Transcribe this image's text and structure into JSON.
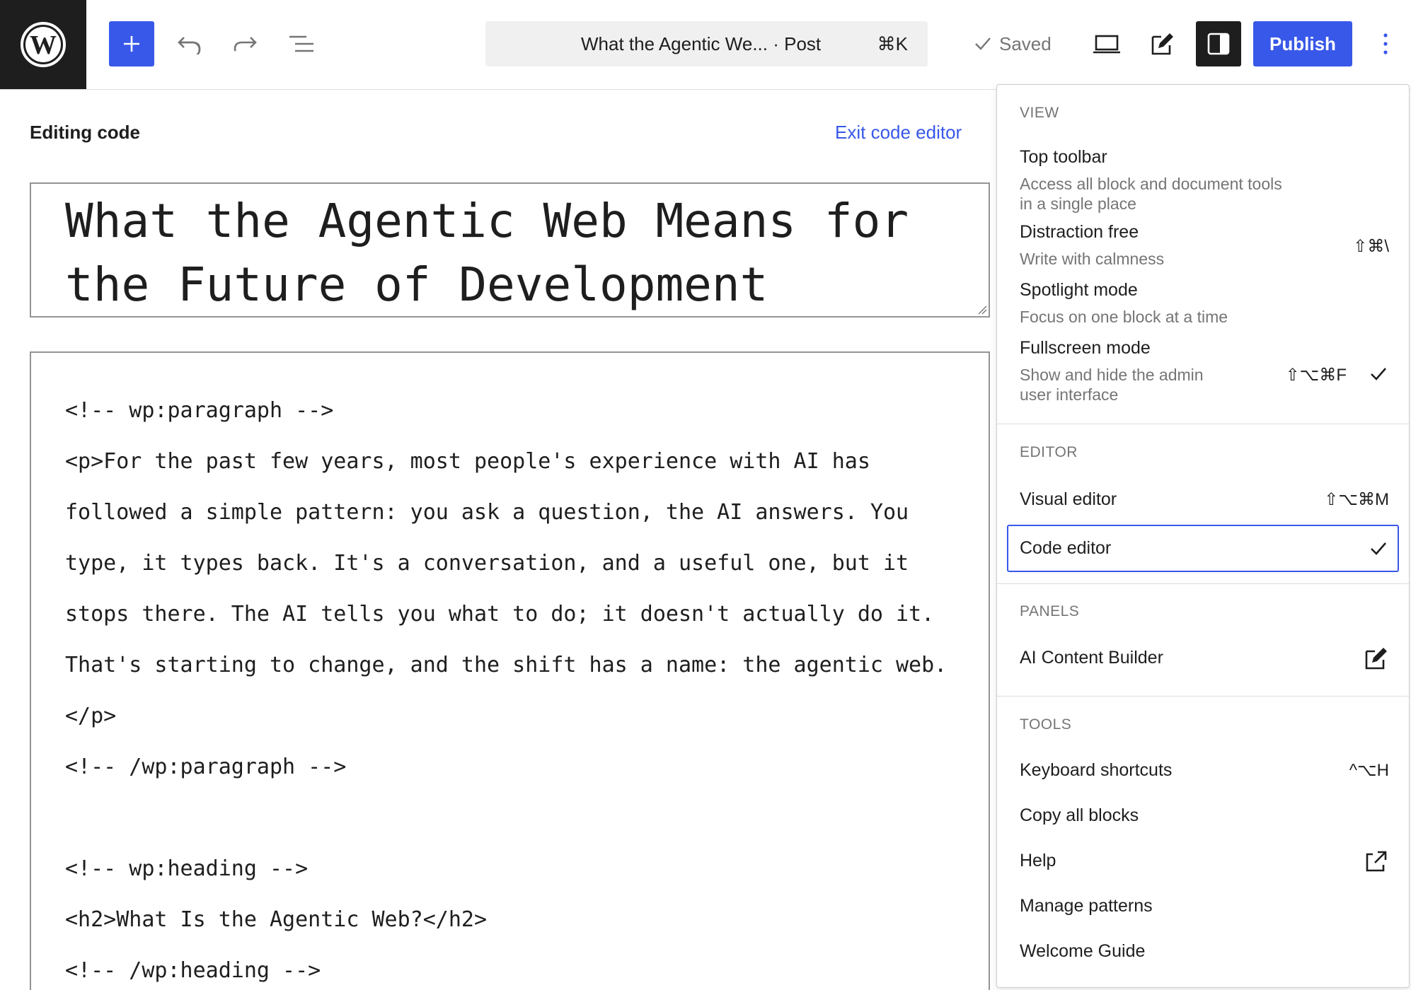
{
  "header": {
    "logo": "wordpress-logo",
    "icons": {
      "inserter": "plus-icon",
      "undo": "undo-icon",
      "redo": "redo-icon",
      "list_view": "list-view-icon",
      "preview": "desktop-icon",
      "edit": "edit-icon",
      "settings": "sidebar-icon",
      "options": "more-vertical-icon"
    },
    "command_bar": {
      "title": "What the Agentic We...",
      "type": "· Post",
      "shortcut": "⌘K"
    },
    "saved_label": "Saved",
    "publish_label": "Publish"
  },
  "editor": {
    "mode_label": "Editing code",
    "exit_label": "Exit code editor",
    "post_title_line1": "What the Agentic Web Means for",
    "post_title_line2": "the Future of Development",
    "code_lines": [
      "<!-- wp:paragraph -->",
      "<p>For the past few years, most people's experience with AI has",
      "followed a simple pattern: you ask a question, the AI answers. You",
      "type, it types back. It's a conversation, and a useful one, but it",
      "stops there. The AI tells you what to do; it doesn't actually do it.",
      "That's starting to change, and the shift has a name: the agentic web.",
      "</p>",
      "<!-- /wp:paragraph -->",
      "<!-- wp:heading -->",
      "<h2>What Is the Agentic Web?</h2>",
      "<!-- /wp:heading -->"
    ]
  },
  "menu": {
    "view": {
      "label": "VIEW",
      "top_toolbar": {
        "title": "Top toolbar",
        "desc_1": "Access all block and document tools",
        "desc_2": "in a single place"
      },
      "distraction_free": {
        "title": "Distraction free",
        "desc": "Write with calmness",
        "shortcut": "⇧⌘\\"
      },
      "spotlight": {
        "title": "Spotlight mode",
        "desc": "Focus on one block at a time"
      },
      "fullscreen": {
        "title": "Fullscreen mode",
        "desc_1": "Show and hide the admin",
        "desc_2": "user interface",
        "shortcut": "⇧⌥⌘F",
        "checked": true
      }
    },
    "editor": {
      "label": "EDITOR",
      "visual": {
        "title": "Visual editor",
        "shortcut": "⇧⌥⌘M"
      },
      "code": {
        "title": "Code editor",
        "checked": true
      }
    },
    "panels": {
      "label": "PANELS",
      "ai_builder": {
        "title": "AI Content Builder",
        "icon": "edit-icon"
      }
    },
    "tools": {
      "label": "TOOLS",
      "keyboard_shortcuts": {
        "title": "Keyboard shortcuts",
        "shortcut": "^⌥H"
      },
      "copy_all": {
        "title": "Copy all blocks"
      },
      "help": {
        "title": "Help",
        "icon": "external-link-icon"
      },
      "manage_patterns": {
        "title": "Manage patterns"
      },
      "welcome_guide": {
        "title": "Welcome Guide"
      }
    }
  },
  "colors": {
    "accent": "#3858e9",
    "dark": "#1e1e1e",
    "muted": "#757575"
  }
}
